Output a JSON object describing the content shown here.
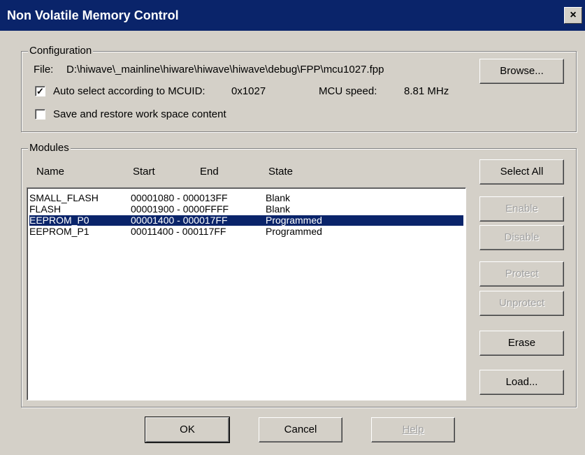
{
  "window": {
    "title": "Non Volatile Memory Control",
    "close_glyph": "×"
  },
  "configuration": {
    "legend": "Configuration",
    "file_label": "File:",
    "file_path": "D:\\hiwave\\_mainline\\hiware\\hiwave\\hiwave\\debug\\FPP\\mcu1027.fpp",
    "browse_label": "Browse...",
    "auto_select": {
      "checked": true,
      "label": "Auto select according to MCUID:",
      "value": "0x1027"
    },
    "mcu_speed_label": "MCU speed:",
    "mcu_speed_value": "8.81 MHz",
    "save_restore": {
      "checked": false,
      "label": "Save and restore work space content"
    }
  },
  "modules": {
    "legend": "Modules",
    "columns": [
      "Name",
      "Start",
      "End",
      "State"
    ],
    "rows": [
      {
        "name": "SMALL_FLASH",
        "range": "00001080 - 000013FF",
        "state": "Blank",
        "selected": false
      },
      {
        "name": "FLASH",
        "range": "00001900 - 0000FFFF",
        "state": "Blank",
        "selected": false
      },
      {
        "name": "EEPROM_P0",
        "range": "00001400 - 000017FF",
        "state": "Programmed",
        "selected": true
      },
      {
        "name": "EEPROM_P1",
        "range": "00011400 - 000117FF",
        "state": "Programmed",
        "selected": false
      }
    ],
    "buttons": {
      "select_all": "Select All",
      "enable": "Enable",
      "disable": "Disable",
      "protect": "Protect",
      "unprotect": "Unprotect",
      "erase": "Erase",
      "load": "Load..."
    }
  },
  "footer": {
    "ok": "OK",
    "cancel": "Cancel",
    "help": "Help"
  }
}
